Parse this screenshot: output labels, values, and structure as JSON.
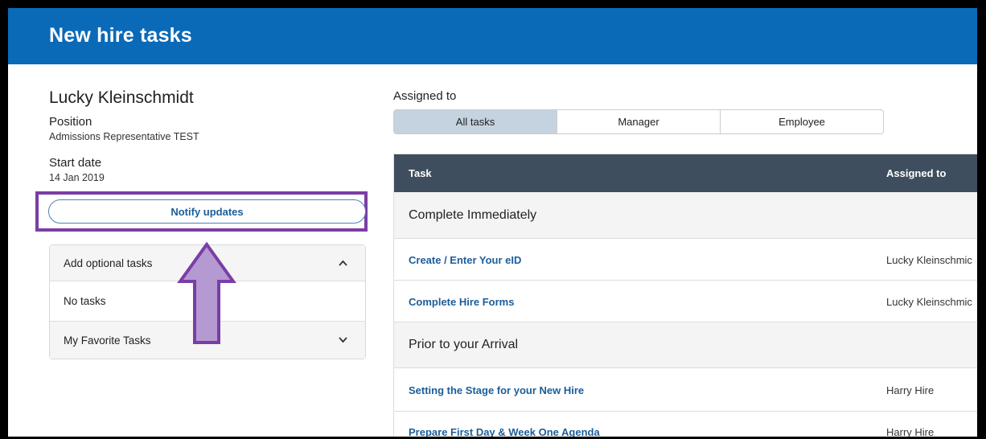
{
  "header": {
    "title": "New hire tasks"
  },
  "employee": {
    "name": "Lucky Kleinschmidt",
    "position_label": "Position",
    "position_value": "Admissions Representative TEST",
    "start_label": "Start date",
    "start_value": "14 Jan 2019"
  },
  "notify_button": {
    "label": "Notify updates"
  },
  "optional_tasks": {
    "header_label": "Add optional tasks",
    "empty_text": "No tasks",
    "favorites_label": "My Favorite Tasks"
  },
  "assigned_filter": {
    "label": "Assigned to",
    "options": [
      "All tasks",
      "Manager",
      "Employee"
    ],
    "selected": "All tasks"
  },
  "table": {
    "columns": [
      "Task",
      "Assigned to"
    ],
    "groups": [
      {
        "title": "Complete Immediately",
        "tasks": [
          {
            "name": "Create / Enter Your eID",
            "assignee": "Lucky Kleinschmic"
          },
          {
            "name": "Complete Hire Forms",
            "assignee": "Lucky Kleinschmic"
          }
        ]
      },
      {
        "title": "Prior to your Arrival",
        "tasks": [
          {
            "name": "Setting the Stage for your New Hire",
            "assignee": "Harry Hire"
          },
          {
            "name": "Prepare First Day & Week One Agenda",
            "assignee": "Harry Hire"
          }
        ]
      }
    ]
  },
  "colors": {
    "header_bg": "#0b6ab8",
    "table_header_bg": "#3e4e5e",
    "link": "#1c5d9a",
    "annotation": "#7a3ea6",
    "annotation_fill": "#b49ad0"
  },
  "icons": {
    "expand_up": "chevron-up-icon",
    "expand_down": "chevron-down-icon",
    "annotation": "up-arrow-icon"
  }
}
